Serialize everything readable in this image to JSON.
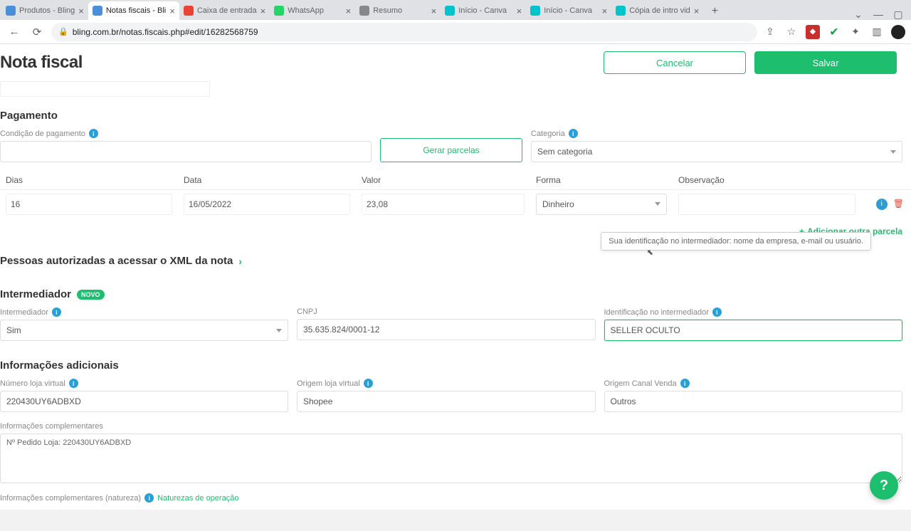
{
  "browser": {
    "tabs": [
      {
        "title": "Produtos - Bling",
        "icon": "#4a90d9"
      },
      {
        "title": "Notas fiscais - Bli",
        "icon": "#4a90d9",
        "active": true
      },
      {
        "title": "Caixa de entrada",
        "icon": "#ea4335"
      },
      {
        "title": "WhatsApp",
        "icon": "#25d366"
      },
      {
        "title": "Resumo",
        "icon": "#888"
      },
      {
        "title": "Início - Canva",
        "icon": "#00c4cc"
      },
      {
        "title": "Início - Canva",
        "icon": "#00c4cc"
      },
      {
        "title": "Cópia de intro vid",
        "icon": "#00c4cc"
      }
    ],
    "url": "bling.com.br/notas.fiscais.php#edit/16282568759"
  },
  "header": {
    "title": "Nota fiscal",
    "cancel": "Cancelar",
    "save": "Salvar"
  },
  "pagamento": {
    "section": "Pagamento",
    "condicao_lbl": "Condição de pagamento",
    "gerar": "Gerar parcelas",
    "categoria_lbl": "Categoria",
    "categoria_val": "Sem categoria",
    "cols": {
      "dias": "Dias",
      "data": "Data",
      "valor": "Valor",
      "forma": "Forma",
      "obs": "Observação"
    },
    "row": {
      "dias": "16",
      "data": "16/05/2022",
      "valor": "23,08",
      "forma": "Dinheiro",
      "obs": ""
    },
    "add": "Adicionar outra parcela"
  },
  "xml": {
    "title": "Pessoas autorizadas a acessar o XML da nota"
  },
  "intermediador": {
    "section": "Intermediador",
    "badge": "NOVO",
    "inter_lbl": "Intermediador",
    "inter_val": "Sim",
    "cnpj_lbl": "CNPJ",
    "cnpj_val": "35.635.824/0001-12",
    "ident_lbl": "Identificação no intermediador",
    "ident_val": "SELLER OCULTO",
    "tooltip": "Sua identificação no intermediador: nome da empresa, e-mail ou usuário."
  },
  "info": {
    "section": "Informações adicionais",
    "loja_lbl": "Número loja virtual",
    "loja_val": "220430UY6ADBXD",
    "origem_lbl": "Origem loja virtual",
    "origem_val": "Shopee",
    "canal_lbl": "Origem Canal Venda",
    "canal_val": "Outros",
    "compl_lbl": "Informações complementares",
    "compl_val": "Nº Pedido Loja: 220430UY6ADBXD",
    "natur_lbl": "Informações complementares (natureza)",
    "natur_link": "Naturezas de operação"
  }
}
